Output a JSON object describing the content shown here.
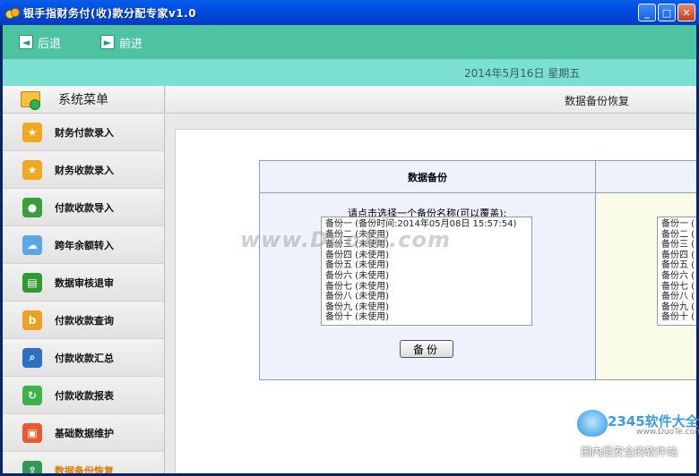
{
  "window": {
    "title": "银手指财务付(收)款分配专家v1.0",
    "minimize": "_",
    "maximize": "□",
    "close": "✕"
  },
  "toolbar": {
    "back_label": "后退",
    "forward_label": "前进",
    "back_icon": "◄",
    "forward_icon": "►"
  },
  "datebar": {
    "date": "2014年5月16日  星期五"
  },
  "sidebar": {
    "header": "系统菜单",
    "items": [
      {
        "label": "财务付款录入",
        "icon": "star-icon",
        "glyph": "★",
        "color": "#f2a81e"
      },
      {
        "label": "财务收款录入",
        "icon": "star-icon",
        "glyph": "★",
        "color": "#f2a81e"
      },
      {
        "label": "付款收款导入",
        "icon": "chat-icon",
        "glyph": "●",
        "color": "#3a9e3a"
      },
      {
        "label": "跨年余额转入",
        "icon": "cloud-icon",
        "glyph": "☁",
        "color": "#5aa6e6"
      },
      {
        "label": "数据审核退审",
        "icon": "basket-icon",
        "glyph": "▤",
        "color": "#2f9a2f"
      },
      {
        "label": "付款收款查询",
        "icon": "b-icon",
        "glyph": "b",
        "color": "#f0a020"
      },
      {
        "label": "付款收款汇总",
        "icon": "search-icon",
        "glyph": "⌕",
        "color": "#2d6fc7"
      },
      {
        "label": "付款收款报表",
        "icon": "refresh-icon",
        "glyph": "↻",
        "color": "#3bb34a"
      },
      {
        "label": "基础数据维护",
        "icon": "gift-icon",
        "glyph": "▣",
        "color": "#e85a2e"
      },
      {
        "label": "数据备份恢复",
        "icon": "share-icon",
        "glyph": "⇪",
        "color": "#2e9a56"
      }
    ]
  },
  "main": {
    "title": "数据备份恢复",
    "backup": {
      "heading": "数据备份",
      "prompt": "请点击选择一个备份名称(可以覆盖):",
      "items": [
        "备份一  (备份时间:2014年05月08日 15:57:54)",
        "备份二  (未使用)",
        "备份三  (未使用)",
        "备份四  (未使用)",
        "备份五  (未使用)",
        "备份六  (未使用)",
        "备份七  (未使用)",
        "备份八  (未使用)",
        "备份九  (未使用)",
        "备份十  (未使用)"
      ],
      "button": "备份"
    },
    "restore": {
      "items": [
        "备份一 (",
        "备份二 (",
        "备份三 (",
        "备份四 (",
        "备份五 (",
        "备份六 (",
        "备份七 (",
        "备份八 (",
        "备份九 (",
        "备份十 ("
      ]
    }
  },
  "watermark": "www.DuoTe.com",
  "corner_logo": {
    "brand": "2345软件大全",
    "site": "www.DuoTe.com",
    "slogan": "国内最安全的软件站"
  }
}
